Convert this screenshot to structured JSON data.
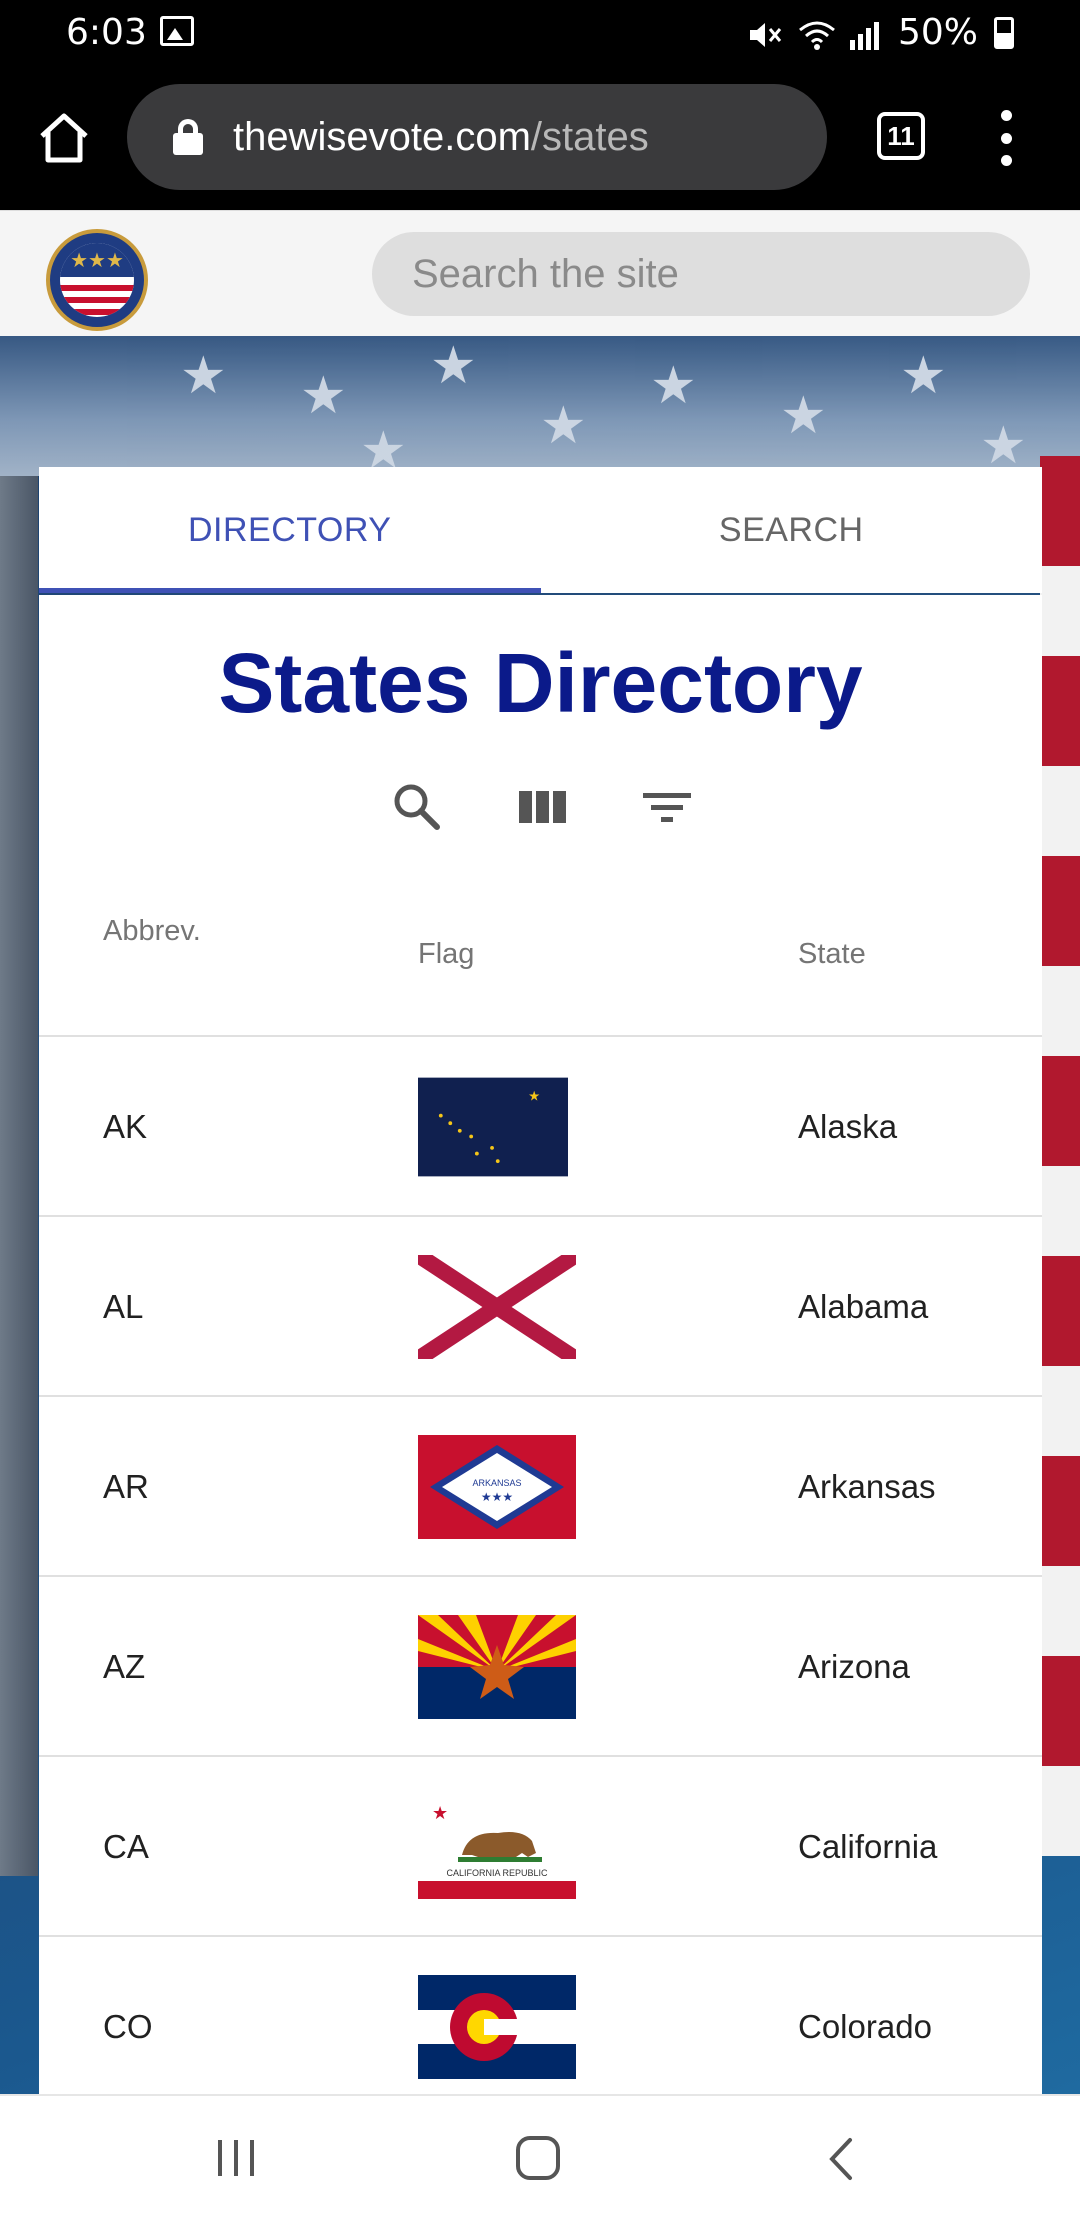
{
  "status_bar": {
    "time": "6:03",
    "battery": "50%",
    "icons": [
      "image-icon",
      "mute-icon",
      "wifi-icon",
      "signal-icon",
      "battery-icon"
    ]
  },
  "browser": {
    "url_domain": "thewisevote.com",
    "url_path": "/states",
    "tab_count": "11"
  },
  "site_header": {
    "search_placeholder": "Search the site"
  },
  "tabs": [
    {
      "label": "DIRECTORY",
      "active": true
    },
    {
      "label": "SEARCH",
      "active": false
    }
  ],
  "directory": {
    "title": "States Directory",
    "toolbar_icons": [
      "search-icon",
      "columns-icon",
      "filter-icon"
    ],
    "columns": {
      "abbrev": "Abbrev.",
      "flag": "Flag",
      "state": "State"
    },
    "rows": [
      {
        "abbrev": "AK",
        "state": "Alaska",
        "flag_text": ""
      },
      {
        "abbrev": "AL",
        "state": "Alabama",
        "flag_text": ""
      },
      {
        "abbrev": "AR",
        "state": "Arkansas",
        "flag_text": "ARKANSAS"
      },
      {
        "abbrev": "AZ",
        "state": "Arizona",
        "flag_text": ""
      },
      {
        "abbrev": "CA",
        "state": "California",
        "flag_text": "CALIFORNIA REPUBLIC"
      },
      {
        "abbrev": "CO",
        "state": "Colorado",
        "flag_text": ""
      }
    ]
  },
  "colors": {
    "accent": "#3f51b5",
    "title": "#0b1a8a",
    "tab_inactive": "#666666"
  }
}
